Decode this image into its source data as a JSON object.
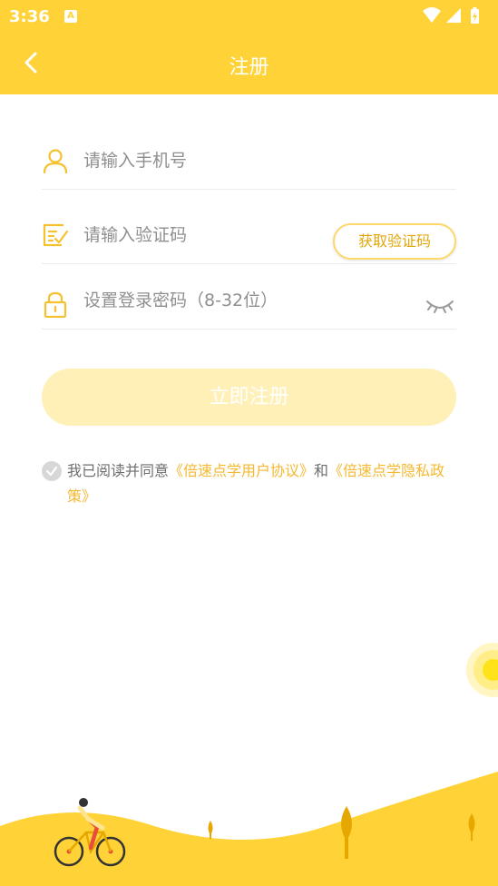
{
  "status_bar": {
    "time": "3:36",
    "notification_icon": "A"
  },
  "header": {
    "title": "注册",
    "back_icon": "chevron-left-icon"
  },
  "form": {
    "phone": {
      "placeholder": "请输入手机号",
      "value": ""
    },
    "code": {
      "placeholder": "请输入验证码",
      "value": "",
      "button_label": "获取验证码"
    },
    "password": {
      "placeholder": "设置登录密码（8-32位）",
      "value": ""
    },
    "submit_label": "立即注册"
  },
  "agreement": {
    "prefix": "我已阅读并同意",
    "user_agreement": "《倍速点学用户协议》",
    "and": "和",
    "privacy_policy": "《倍速点学隐私政策》"
  },
  "colors": {
    "brand": "#ffd337",
    "link": "#f5b82e",
    "submit_disabled": "#fff0b8"
  }
}
